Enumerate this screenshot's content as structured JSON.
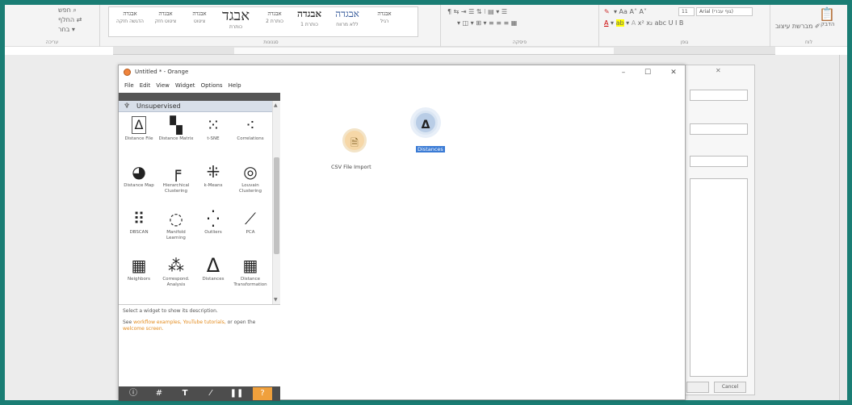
{
  "ribbon": {
    "left_group": {
      "items": [
        "בחר",
        "החלף",
        "חפש"
      ],
      "label": "עריכה"
    },
    "styles": [
      {
        "sample": "אבגדה",
        "name": "הדגשה חזקה"
      },
      {
        "sample": "אבגדה",
        "name": "ציטוט חזק"
      },
      {
        "sample": "אבגדה",
        "name": "ציטוט"
      },
      {
        "sample": "אבגד",
        "name": "כותרת"
      },
      {
        "sample": "אבגדה",
        "name": "כותרת 2"
      },
      {
        "sample": "אבגדה",
        "name": "כותרת 1"
      },
      {
        "sample": "אבגדה",
        "name": "ללא מרווח"
      },
      {
        "sample": "אבגדה",
        "name": "רגיל"
      }
    ],
    "styles_label": "סגנונות",
    "paragraph_label": "פיסקה",
    "font_label": "גופן",
    "font_name": "Arial (גוף עברי)",
    "font_size": "11",
    "clipboard": {
      "paste": "הדבק",
      "format_painter": "מברשת עיצוב",
      "label": "לוח"
    }
  },
  "orange": {
    "title": "Untitled * - Orange",
    "menu": [
      "File",
      "Edit",
      "View",
      "Widget",
      "Options",
      "Help"
    ],
    "category": "Unsupervised",
    "widgets": [
      {
        "icon": "distance-file-icon",
        "glyph": "Δ",
        "label": "Distance File"
      },
      {
        "icon": "distance-matrix-icon",
        "glyph": "▚",
        "label": "Distance Matrix"
      },
      {
        "icon": "distance-map-icon",
        "glyph": "⁙",
        "label": "t-SNE"
      },
      {
        "icon": "correlations-icon",
        "glyph": "⁖",
        "label": "Correlations"
      },
      {
        "icon": "distance-map-icon",
        "glyph": "◕",
        "label": "Distance Map"
      },
      {
        "icon": "hierarchical-clustering-icon",
        "glyph": "╒",
        "label": "Hierarchical Clustering"
      },
      {
        "icon": "k-means-icon",
        "glyph": "⁜",
        "label": "k-Means"
      },
      {
        "icon": "louvain-clustering-icon",
        "glyph": "◎",
        "label": "Louvain Clustering"
      },
      {
        "icon": "dbscan-icon",
        "glyph": "⠿",
        "label": "DBSCAN"
      },
      {
        "icon": "manifold-learning-icon",
        "glyph": "◌",
        "label": "Manifold Learning"
      },
      {
        "icon": "outliers-icon",
        "glyph": "⁛",
        "label": "Outliers"
      },
      {
        "icon": "pca-icon",
        "glyph": "⟋",
        "label": "PCA"
      },
      {
        "icon": "neighbors-icon",
        "glyph": "▦",
        "label": "Neighbors"
      },
      {
        "icon": "correspondence-analysis-icon",
        "glyph": "⁂",
        "label": "Correspond. Analysis"
      },
      {
        "icon": "distances-icon",
        "glyph": "Δ",
        "label": "Distances"
      },
      {
        "icon": "distance-transformation-icon",
        "glyph": "▦",
        "label": "Distance Transformation"
      }
    ],
    "description": {
      "line1": "Select a widget to show its description.",
      "line2_prefix": "See",
      "line2_link": "workflow examples, YouTube tutorials,",
      "line2_mid": "or open the",
      "line2_link2": "welcome screen."
    },
    "toolbar_icons": [
      "info-icon",
      "grid-icon",
      "text-icon",
      "line-icon",
      "pause-icon",
      "help-icon"
    ],
    "nodes": [
      {
        "id": "csv",
        "label": "CSV File Import",
        "selected": false
      },
      {
        "id": "dist",
        "label": "Distances",
        "selected": true
      }
    ]
  },
  "bg_dialog": {
    "cancel": "Cancel"
  },
  "colors": {
    "frame": "#1a7d74",
    "orange_accent": "#f0843c",
    "selection": "#3a7bd5"
  }
}
